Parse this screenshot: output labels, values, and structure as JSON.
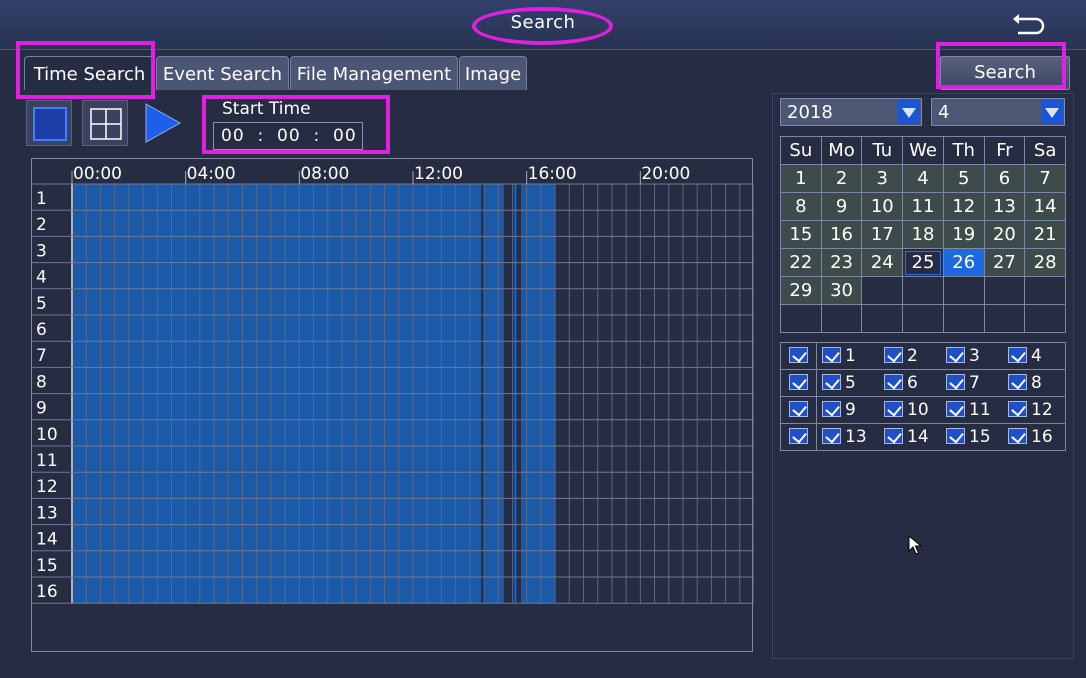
{
  "header": {
    "title": "Search"
  },
  "tabs": [
    {
      "label": "Time Search",
      "active": true
    },
    {
      "label": "Event Search",
      "active": false
    },
    {
      "label": "File Management",
      "active": false
    },
    {
      "label": "Image",
      "active": false
    }
  ],
  "search_button": "Search",
  "toolbar": {
    "icons": [
      "single-view-icon",
      "quad-view-icon",
      "play-icon"
    ],
    "start_time_label": "Start Time",
    "start_time": {
      "h": "00",
      "m": "00",
      "s": "00",
      "sep": ":"
    }
  },
  "timeline": {
    "time_ticks": [
      "00:00",
      "04:00",
      "08:00",
      "12:00",
      "16:00",
      "20:00"
    ],
    "channels": [
      "1",
      "2",
      "3",
      "4",
      "5",
      "6",
      "7",
      "8",
      "9",
      "10",
      "11",
      "12",
      "13",
      "14",
      "15",
      "16"
    ],
    "recording_color": "#1a5aa8",
    "recorded_hours": [
      [
        0,
        14.4
      ],
      [
        14.5,
        15.2
      ],
      [
        15.55,
        15.65
      ],
      [
        15.8,
        17.0
      ]
    ]
  },
  "calendar": {
    "year": "2018",
    "month": "4",
    "weekdays": [
      "Su",
      "Mo",
      "Tu",
      "We",
      "Th",
      "Fr",
      "Sa"
    ],
    "days": [
      [
        "1",
        "2",
        "3",
        "4",
        "5",
        "6",
        "7"
      ],
      [
        "8",
        "9",
        "10",
        "11",
        "12",
        "13",
        "14"
      ],
      [
        "15",
        "16",
        "17",
        "18",
        "19",
        "20",
        "21"
      ],
      [
        "22",
        "23",
        "24",
        "25",
        "26",
        "27",
        "28"
      ],
      [
        "29",
        "30",
        "",
        "",
        "",
        "",
        ""
      ],
      [
        "",
        "",
        "",
        "",
        "",
        "",
        ""
      ]
    ],
    "today": "25",
    "selected": "26",
    "selected_color": "#1d6ae0"
  },
  "channel_select": {
    "rows": [
      [
        "1",
        "2",
        "3",
        "4"
      ],
      [
        "5",
        "6",
        "7",
        "8"
      ],
      [
        "9",
        "10",
        "11",
        "12"
      ],
      [
        "13",
        "14",
        "15",
        "16"
      ]
    ],
    "all_checked": true
  },
  "annotation_color": "#e020e0"
}
